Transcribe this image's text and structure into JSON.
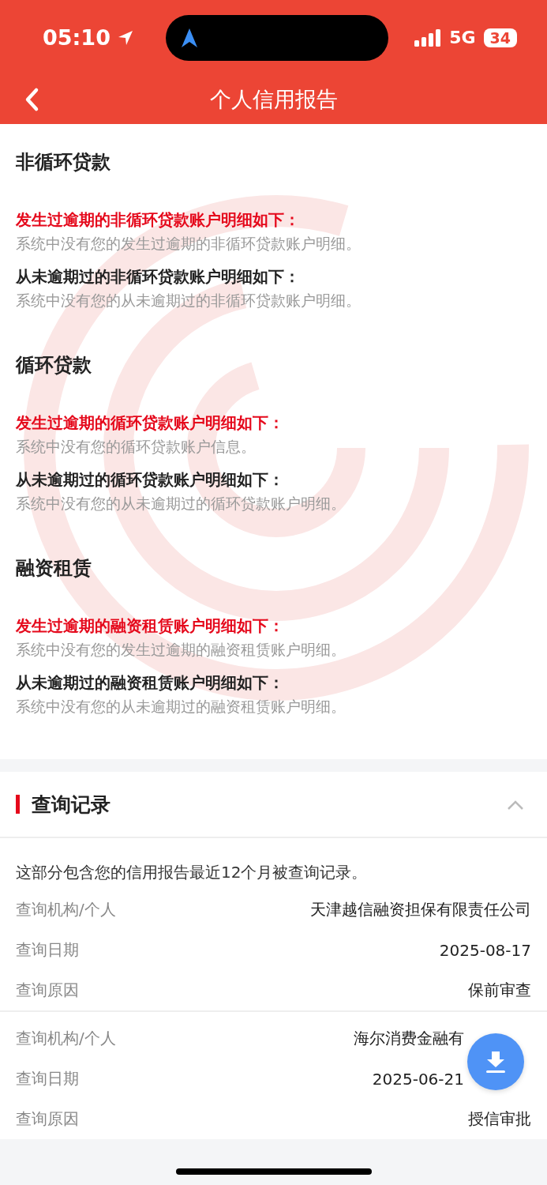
{
  "status_bar": {
    "time": "05:10",
    "network": "5G",
    "battery": "34"
  },
  "nav": {
    "title": "个人信用报告"
  },
  "sections": [
    {
      "title": "非循环贷款",
      "groups": [
        {
          "kind": "overdue",
          "label": "发生过逾期的非循环贷款账户明细如下：",
          "text": "系统中没有您的发生过逾期的非循环贷款账户明细。"
        },
        {
          "kind": "normal",
          "label": "从未逾期过的非循环贷款账户明细如下：",
          "text": "系统中没有您的从未逾期过的非循环贷款账户明细。"
        }
      ]
    },
    {
      "title": "循环贷款",
      "groups": [
        {
          "kind": "overdue",
          "label": "发生过逾期的循环贷款账户明细如下：",
          "text": "系统中没有您的循环贷款账户信息。"
        },
        {
          "kind": "normal",
          "label": "从未逾期过的循环贷款账户明细如下：",
          "text": "系统中没有您的从未逾期过的循环贷款账户明细。"
        }
      ]
    },
    {
      "title": "融资租赁",
      "groups": [
        {
          "kind": "overdue",
          "label": "发生过逾期的融资租赁账户明细如下：",
          "text": "系统中没有您的发生过逾期的融资租赁账户明细。"
        },
        {
          "kind": "normal",
          "label": "从未逾期过的融资租赁账户明细如下：",
          "text": "系统中没有您的从未逾期过的融资租赁账户明细。"
        }
      ]
    }
  ],
  "query": {
    "title": "查询记录",
    "expanded": true,
    "intro": "这部分包含您的信用报告最近12个月被查询记录。",
    "records": [
      {
        "rows": [
          {
            "label": "查询机构/个人",
            "value": "天津越信融资担保有限责任公司"
          },
          {
            "label": "查询日期",
            "value": "2025-08-17"
          },
          {
            "label": "查询原因",
            "value": "保前审查"
          }
        ]
      },
      {
        "rows": [
          {
            "label": "查询机构/个人",
            "value": "海尔消费金融有"
          },
          {
            "label": "查询日期",
            "value": "2025-06-21"
          },
          {
            "label": "查询原因",
            "value": "授信审批"
          }
        ]
      }
    ]
  }
}
